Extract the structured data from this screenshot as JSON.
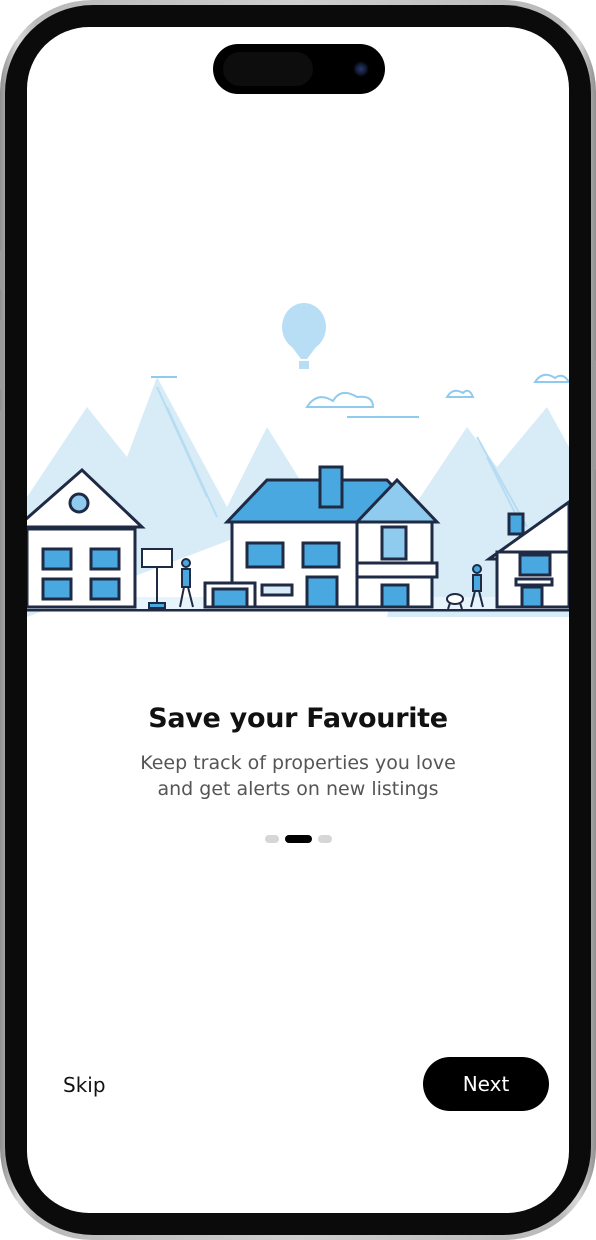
{
  "onboarding": {
    "title": "Save your Favourite",
    "subtitle_line1": "Keep track of properties you love",
    "subtitle_line2": "and get alerts on new listings",
    "page_indicator": {
      "total": 3,
      "current": 2
    }
  },
  "actions": {
    "skip_label": "Skip",
    "next_label": "Next"
  },
  "illustration": {
    "subject": "street-with-houses-illustration",
    "accent_color": "#4aa8e0",
    "light_color": "#d8ecf8",
    "line_color": "#1f2a44"
  },
  "colors": {
    "background": "#ffffff",
    "primary_button": "#000000",
    "dot_inactive": "#d6d6d6"
  }
}
